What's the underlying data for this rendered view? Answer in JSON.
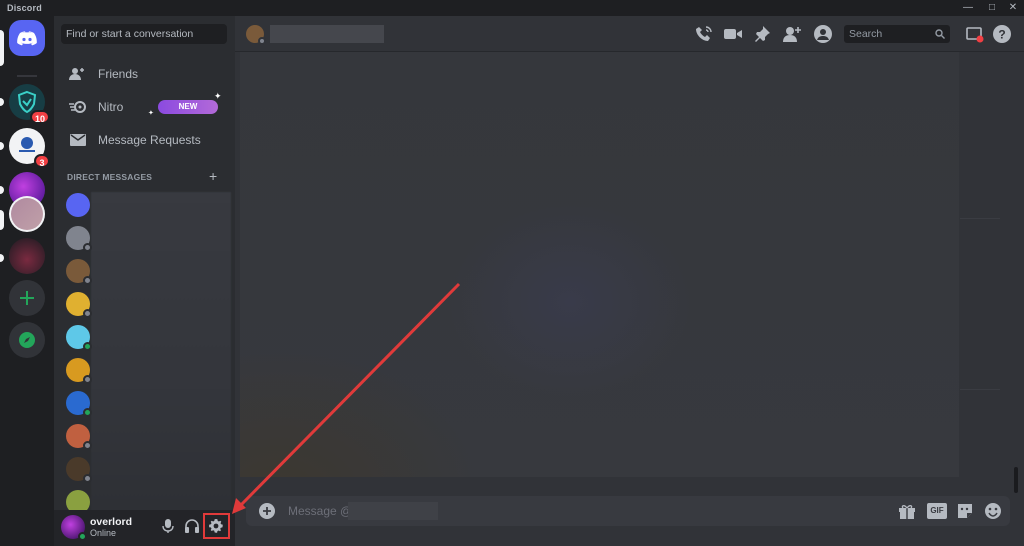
{
  "window": {
    "app_title": "Discord",
    "controls": [
      "minimize",
      "maximize",
      "close"
    ]
  },
  "servers": [
    {
      "name": "home",
      "icon": "discord-logo-icon",
      "color": "#5865f2"
    },
    {
      "name": "server-1",
      "icon": "shield-icon",
      "color": "#1a4a52",
      "mentions": "10"
    },
    {
      "name": "server-2",
      "icon": "circle-logo-icon",
      "color": "#f2f3f5",
      "mentions": "3"
    },
    {
      "name": "server-3",
      "icon": "purple-art-icon",
      "color": "#6a2bb0"
    },
    {
      "name": "server-4",
      "icon": "photo-icon",
      "color": "#b08aa0"
    },
    {
      "name": "server-5",
      "icon": "dark-art-icon",
      "color": "#3a2a30"
    }
  ],
  "dm_panel": {
    "search_placeholder": "Find or start a conversation",
    "nav": [
      {
        "label": "Friends",
        "icon": "friends-icon"
      },
      {
        "label": "Nitro",
        "icon": "nitro-icon",
        "badge": "NEW"
      },
      {
        "label": "Message Requests",
        "icon": "envelope-icon"
      }
    ],
    "direct_messages_header": "DIRECT MESSAGES",
    "dms": [
      {
        "avatar_color": "#5865f2",
        "status": "none"
      },
      {
        "avatar_color": "#80848e",
        "status": "offline"
      },
      {
        "avatar_color": "#7a5a3a",
        "status": "offline"
      },
      {
        "avatar_color": "#e0b030",
        "status": "offline"
      },
      {
        "avatar_color": "#5ec8e8",
        "status": "online"
      },
      {
        "avatar_color": "#d89a20",
        "status": "offline"
      },
      {
        "avatar_color": "#2a6ad0",
        "status": "online"
      },
      {
        "avatar_color": "#c06040",
        "status": "offline"
      },
      {
        "avatar_color": "#4a3a2a",
        "status": "offline"
      },
      {
        "avatar_color": "#8aa040",
        "status": "none"
      }
    ]
  },
  "user": {
    "name": "overlord",
    "status": "Online"
  },
  "chat": {
    "message_placeholder": "Message @"
  },
  "topbar": {
    "search_placeholder": "Search"
  },
  "colors": {
    "accent": "#5865f2",
    "online": "#23a55a",
    "danger": "#f23f43",
    "highlight": "#e03a3a"
  }
}
